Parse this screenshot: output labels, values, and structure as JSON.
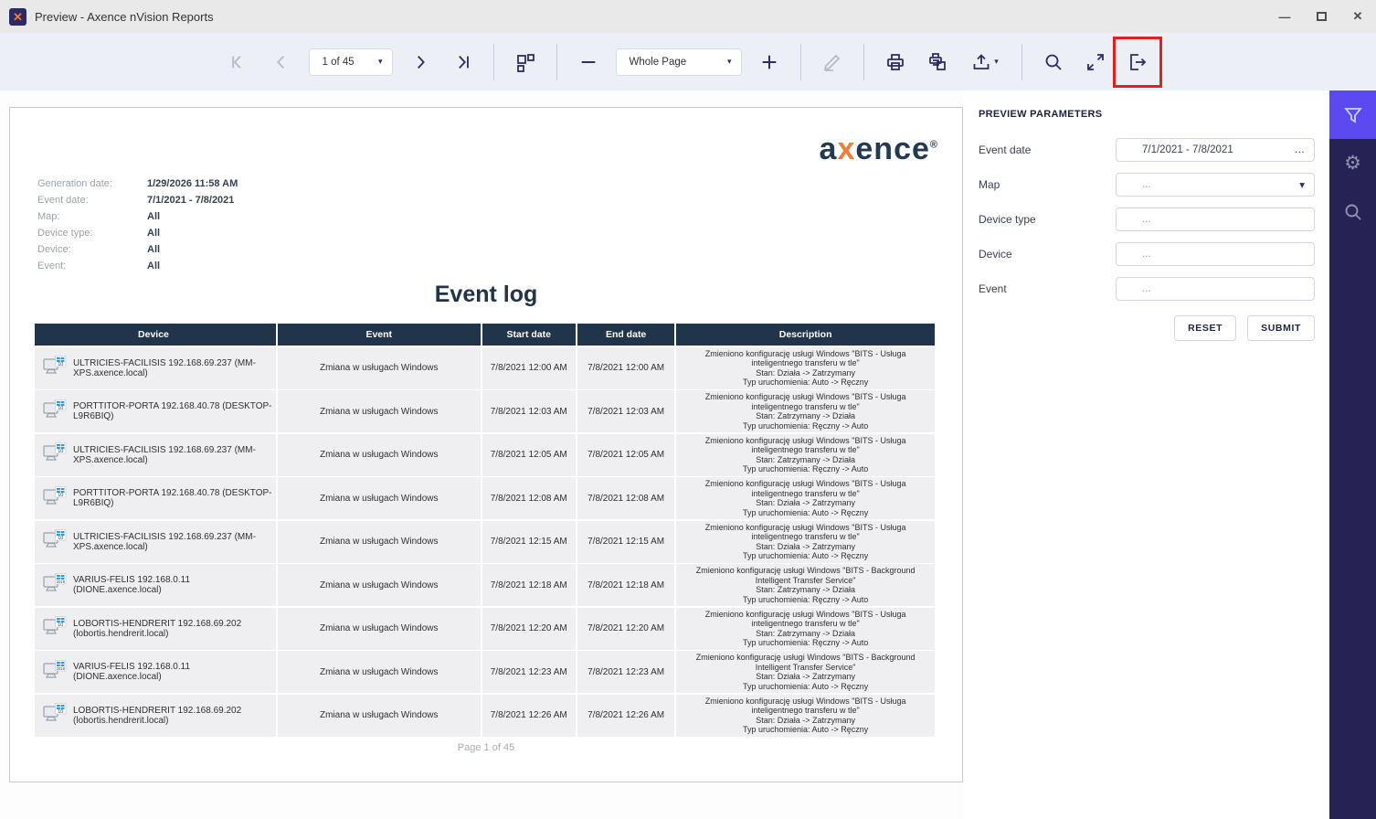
{
  "window": {
    "title": "Preview - Axence nVision Reports",
    "logo_glyph": "✕",
    "controls": {
      "minimize": "—",
      "close": "✕"
    }
  },
  "toolbar": {
    "page_selector": "1 of 45",
    "zoom_selector": "Whole Page",
    "caret_glyph": "▾"
  },
  "report": {
    "logo_prefix": "a",
    "logo_x": "x",
    "logo_suffix": "ence",
    "logo_reg": "®",
    "meta": [
      {
        "label": "Generation date:",
        "value": "1/29/2026 11:58 AM"
      },
      {
        "label": "Event date:",
        "value": "7/1/2021 - 7/8/2021"
      },
      {
        "label": "Map:",
        "value": "All"
      },
      {
        "label": "Device type:",
        "value": "All"
      },
      {
        "label": "Device:",
        "value": "All"
      },
      {
        "label": "Event:",
        "value": "All"
      }
    ],
    "title": "Event log",
    "table": {
      "headers": [
        "Device",
        "Event",
        "Start date",
        "End date",
        "Description"
      ],
      "rows": [
        {
          "device": "ULTRICIES-FACILISIS 192.168.69.237 (MM-XPS.axence.local)",
          "badge": "10",
          "event": "Zmiana w usługach Windows",
          "start": "7/8/2021 12:00 AM",
          "end": "7/8/2021 12:00 AM",
          "description": [
            "Zmieniono konfigurację usługi Windows \"BITS - Usługa",
            "inteligentnego transferu w tle\"",
            "Stan: Działa -> Zatrzymany",
            "Typ uruchomienia: Auto -> Ręczny"
          ]
        },
        {
          "device": "PORTTITOR-PORTA 192.168.40.78 (DESKTOP-L9R6BIQ)",
          "badge": "10",
          "event": "Zmiana w usługach Windows",
          "start": "7/8/2021 12:03 AM",
          "end": "7/8/2021 12:03 AM",
          "description": [
            "Zmieniono konfigurację usługi Windows \"BITS - Usługa",
            "inteligentnego transferu w tle\"",
            "Stan: Zatrzymany -> Działa",
            "Typ uruchomienia: Ręczny -> Auto"
          ]
        },
        {
          "device": "ULTRICIES-FACILISIS 192.168.69.237 (MM-XPS.axence.local)",
          "badge": "10",
          "event": "Zmiana w usługach Windows",
          "start": "7/8/2021 12:05 AM",
          "end": "7/8/2021 12:05 AM",
          "description": [
            "Zmieniono konfigurację usługi Windows \"BITS - Usługa",
            "inteligentnego transferu w tle\"",
            "Stan: Zatrzymany -> Działa",
            "Typ uruchomienia: Ręczny -> Auto"
          ]
        },
        {
          "device": "PORTTITOR-PORTA 192.168.40.78 (DESKTOP-L9R6BIQ)",
          "badge": "10",
          "event": "Zmiana w usługach Windows",
          "start": "7/8/2021 12:08 AM",
          "end": "7/8/2021 12:08 AM",
          "description": [
            "Zmieniono konfigurację usługi Windows \"BITS - Usługa",
            "inteligentnego transferu w tle\"",
            "Stan: Działa -> Zatrzymany",
            "Typ uruchomienia: Auto -> Ręczny"
          ]
        },
        {
          "device": "ULTRICIES-FACILISIS 192.168.69.237 (MM-XPS.axence.local)",
          "badge": "10",
          "event": "Zmiana w usługach Windows",
          "start": "7/8/2021 12:15 AM",
          "end": "7/8/2021 12:15 AM",
          "description": [
            "Zmieniono konfigurację usługi Windows \"BITS - Usługa",
            "inteligentnego transferu w tle\"",
            "Stan: Działa -> Zatrzymany",
            "Typ uruchomienia: Auto -> Ręczny"
          ]
        },
        {
          "device": "VARIUS-FELIS 192.168.0.11 (DIONE.axence.local)",
          "badge": "2019",
          "event": "Zmiana w usługach Windows",
          "start": "7/8/2021 12:18 AM",
          "end": "7/8/2021 12:18 AM",
          "description": [
            "Zmieniono konfigurację usługi Windows \"BITS - Background",
            "Intelligent Transfer Service\"",
            "Stan: Zatrzymany -> Działa",
            "Typ uruchomienia: Ręczny -> Auto"
          ]
        },
        {
          "device": "LOBORTIS-HENDRERIT 192.168.69.202 (lobortis.hendrerit.local)",
          "badge": "10",
          "event": "Zmiana w usługach Windows",
          "start": "7/8/2021 12:20 AM",
          "end": "7/8/2021 12:20 AM",
          "description": [
            "Zmieniono konfigurację usługi Windows \"BITS - Usługa",
            "inteligentnego transferu w tle\"",
            "Stan: Zatrzymany -> Działa",
            "Typ uruchomienia: Ręczny -> Auto"
          ]
        },
        {
          "device": "VARIUS-FELIS 192.168.0.11 (DIONE.axence.local)",
          "badge": "2019",
          "event": "Zmiana w usługach Windows",
          "start": "7/8/2021 12:23 AM",
          "end": "7/8/2021 12:23 AM",
          "description": [
            "Zmieniono konfigurację usługi Windows \"BITS - Background",
            "Intelligent Transfer Service\"",
            "Stan: Działa -> Zatrzymany",
            "Typ uruchomienia: Auto -> Ręczny"
          ]
        },
        {
          "device": "LOBORTIS-HENDRERIT 192.168.69.202 (lobortis.hendrerit.local)",
          "badge": "10",
          "event": "Zmiana w usługach Windows",
          "start": "7/8/2021 12:26 AM",
          "end": "7/8/2021 12:26 AM",
          "description": [
            "Zmieniono konfigurację usługi Windows \"BITS - Usługa",
            "inteligentnego transferu w tle\"",
            "Stan: Działa -> Zatrzymany",
            "Typ uruchomienia: Auto -> Ręczny"
          ]
        }
      ]
    },
    "footer": "Page 1 of 45"
  },
  "parameters": {
    "title": "PREVIEW PARAMETERS",
    "fields": [
      {
        "label": "Event date",
        "value": "7/1/2021 - 7/8/2021"
      },
      {
        "label": "Map",
        "value": "..."
      },
      {
        "label": "Device type",
        "value": "..."
      },
      {
        "label": "Device",
        "value": "..."
      },
      {
        "label": "Event",
        "value": "..."
      }
    ],
    "ellipsis_glyph": "…",
    "caret_glyph": "▾",
    "reset_label": "RESET",
    "submit_label": "SUBMIT"
  },
  "icons": {
    "gear": "⚙"
  },
  "colors": {
    "accent_purple": "#5a4af0",
    "sidebar_navy": "#272254",
    "toolbar_icon_navy": "#2e2b6b",
    "table_header_navy": "#20344a",
    "logo_orange": "#ef7d3b",
    "annotation_red": "#e01f1f"
  }
}
